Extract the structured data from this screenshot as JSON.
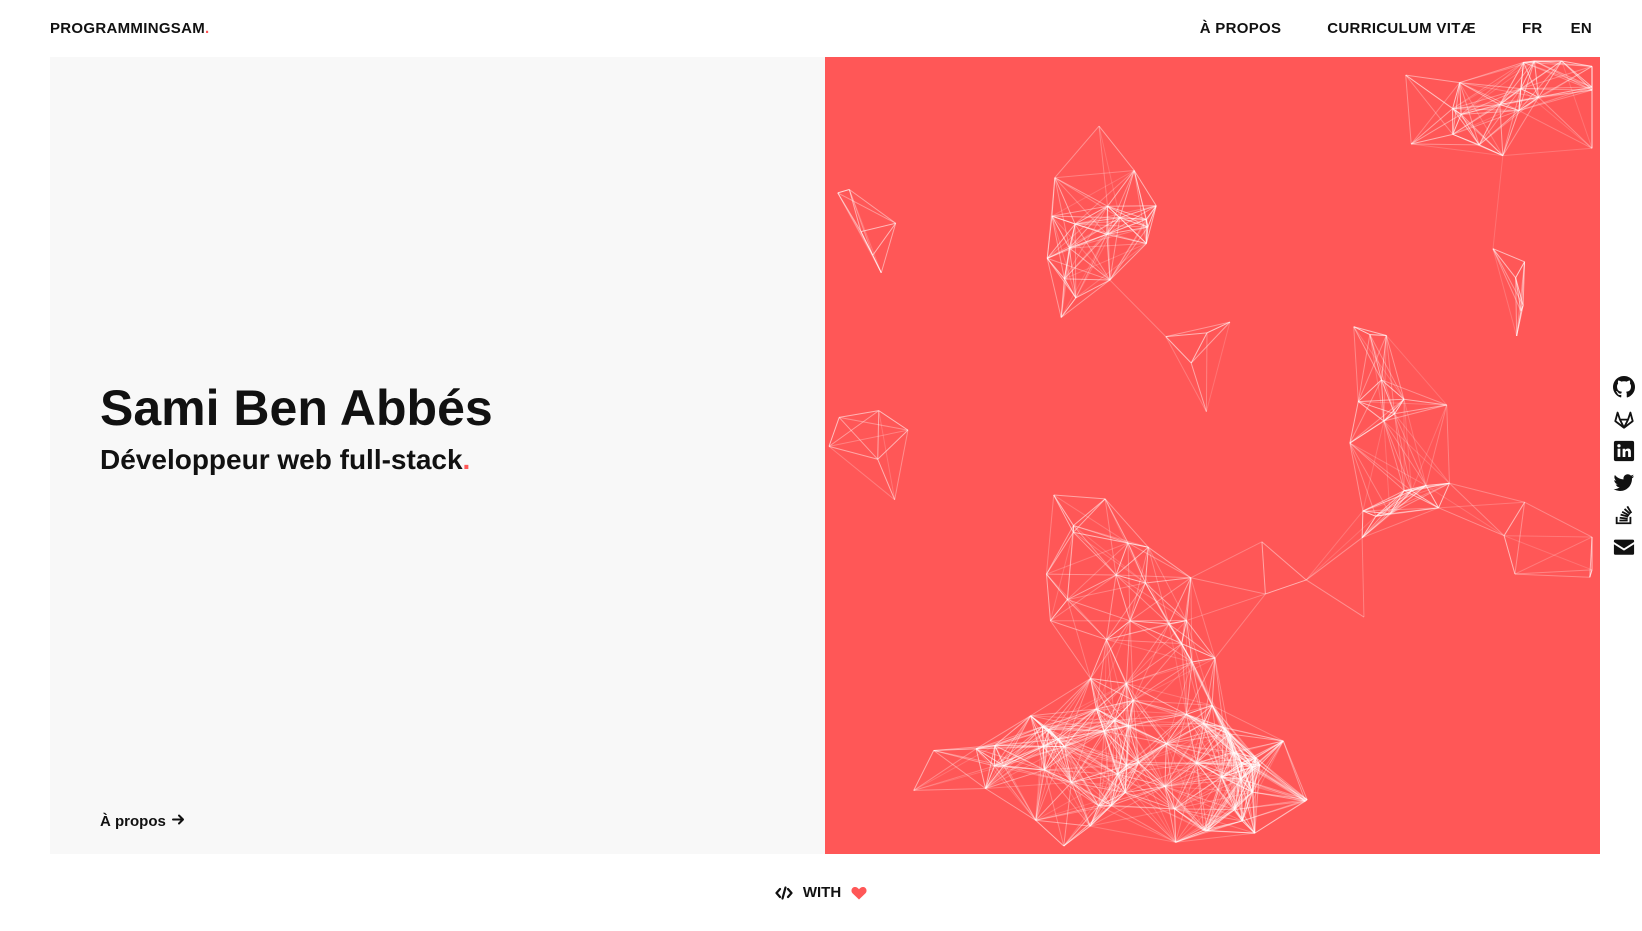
{
  "header": {
    "brand": "PROGRAMMINGSAM",
    "brand_dot": ".",
    "nav": [
      {
        "label": "À PROPOS"
      },
      {
        "label": "CURRICULUM VITÆ"
      }
    ],
    "languages": [
      "FR",
      "EN"
    ]
  },
  "hero": {
    "title": "Sami Ben Abbés",
    "subtitle": "Développeur web full-stack",
    "subtitle_dot": ".",
    "about_link": "À propos"
  },
  "social": [
    {
      "icon": "github-icon"
    },
    {
      "icon": "gitlab-icon"
    },
    {
      "icon": "linkedin-icon"
    },
    {
      "icon": "twitter-icon"
    },
    {
      "icon": "stackoverflow-icon"
    },
    {
      "icon": "envelope-icon"
    }
  ],
  "footer": {
    "text": "WITH",
    "icons": [
      "code-icon",
      "heart-icon"
    ]
  },
  "colors": {
    "accent": "#ff5757",
    "panel": "#f8f8f8",
    "text": "#111111"
  }
}
